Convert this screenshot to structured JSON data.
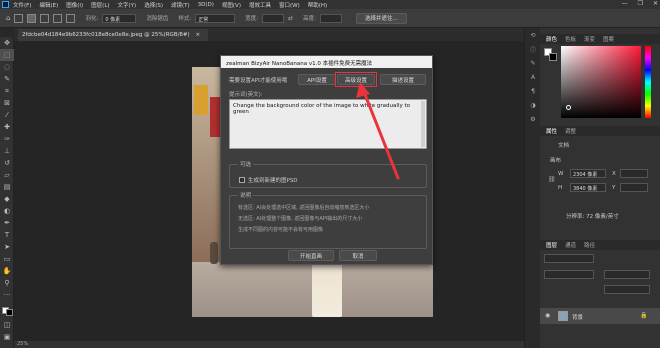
{
  "menubar": {
    "items": [
      "文件(F)",
      "编辑(E)",
      "图像(I)",
      "图层(L)",
      "文字(Y)",
      "选择(S)",
      "滤镜(T)",
      "3D(D)",
      "视图(V)",
      "增效工具",
      "窗口(W)",
      "帮助(H)"
    ],
    "window_controls": [
      "—",
      "❐",
      "✕"
    ]
  },
  "options": {
    "feather_label": "羽化:",
    "feather_value": "0 像素",
    "antialias_label": "消除锯齿",
    "style_label": "样式:",
    "style_value": "正常",
    "width_label": "宽度:",
    "height_label": "高度:",
    "select_subject_button": "选择并遮住..."
  },
  "document": {
    "tab_title": "2fdcbe04d184e9b6233fc018e8ce0e8e.jpeg @ 25%(RGB/8#)",
    "tab_close": "×",
    "status": "25%"
  },
  "dialog": {
    "title": "zealman BizyAir NanoBanana v1.0 本插件免费无需魔法",
    "prompt_note": "需要设置API才能使用哦",
    "api_button": "API设置",
    "advanced_button": "高级设置",
    "desc_button": "描述设置",
    "hint_label": "提示词(英文):",
    "prompt_text": "Change the background color of the image to white gradually to green",
    "optional_header": "可选",
    "psd_checkbox_label": "生成到新建的图PSD",
    "help_header": "说明",
    "help_lines": [
      "有选区: AI会处理选中区域, 返回图像后自动缩放到选区大小",
      "无选区: AI处理整个图像, 返回图像与API输出的尺寸大小",
      "生成不同图的内容可能不会有可用图像"
    ],
    "start_button": "开始直画",
    "cancel_button": "取消"
  },
  "right_panel": {
    "color_tabs": [
      "颜色",
      "色板",
      "渐变",
      "图案"
    ],
    "props_tabs": [
      "属性",
      "调整"
    ],
    "doc_label": "文档",
    "canvas_label": "画布",
    "width_label": "W",
    "width_value": "2304 像素",
    "height_label": "H",
    "height_value": "3840 像素",
    "x_label": "X",
    "y_label": "Y",
    "resolution": "分辨率: 72 像素/英寸",
    "layers_tabs": [
      "图层",
      "通道",
      "路径"
    ],
    "layer_name": "背景"
  },
  "colors": {
    "accent_red": "#e8343c",
    "fg_color": "#ffffff",
    "bg_color": "#000000"
  }
}
